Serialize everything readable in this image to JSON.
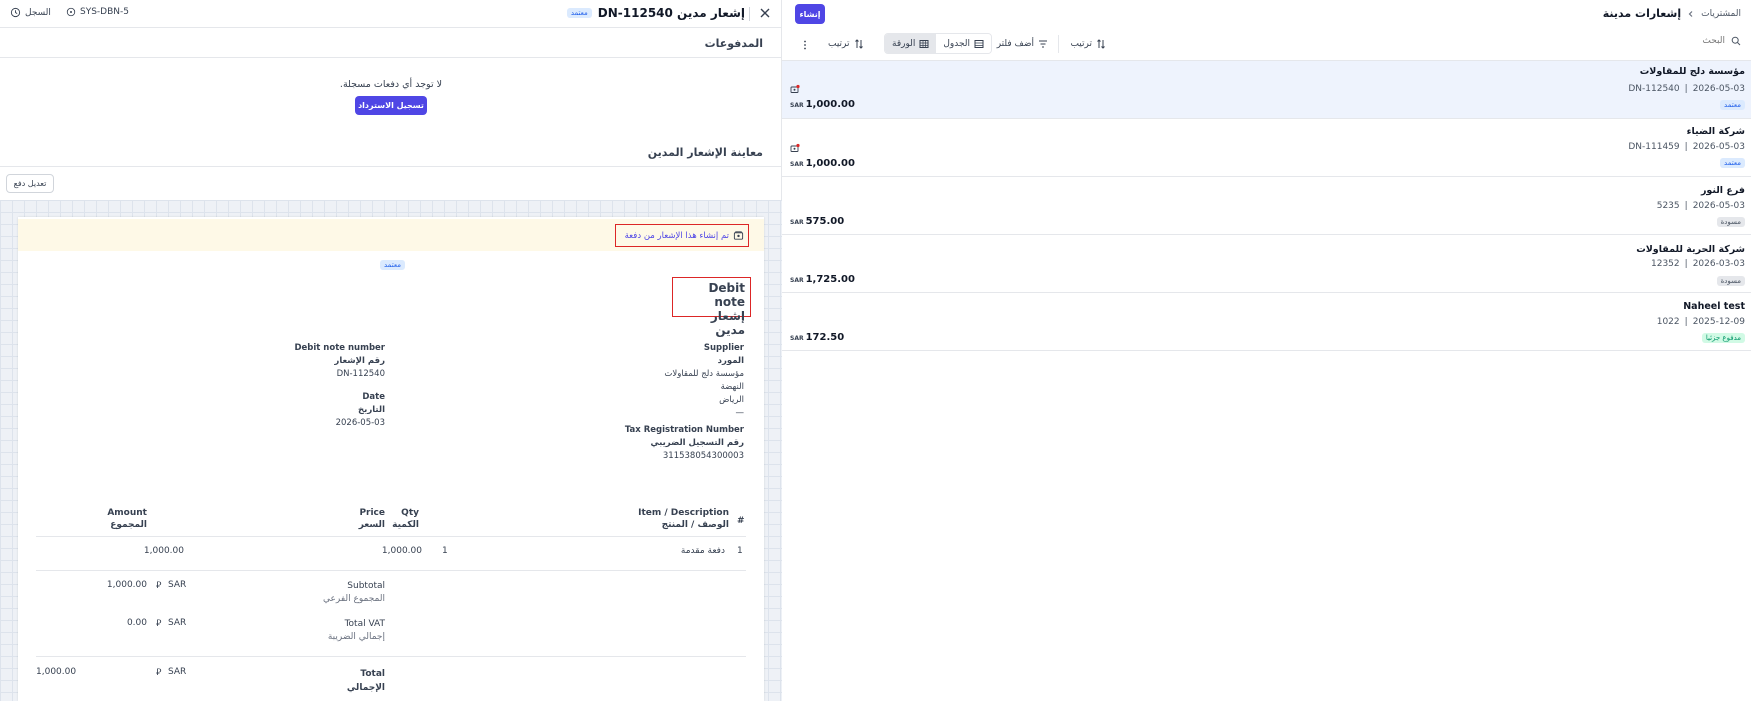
{
  "detail": {
    "header": {
      "title": "إشعار مدين DN-112540",
      "status_badge": "معتمد",
      "doc_ref": "SYS-DBN-5",
      "history_label": "السجل"
    },
    "payments": {
      "title": "المدفوعات",
      "empty_text": "لا توجد أي دفعات مسجلة.",
      "record_refund_label": "تسجيل الاسترداد"
    },
    "preview": {
      "title": "معاينة الإشعار المدين",
      "edit_payment_label": "تعديل دفع"
    },
    "document": {
      "banner_text": "تم إنشاء هذا الإشعار من دفعة",
      "status_badge": "معتمد",
      "title_en": "Debit note",
      "title_ar": "إشعار مدين",
      "supplier_label_en": "Supplier",
      "supplier_label_ar": "المورد",
      "supplier_name": "مؤسسة دلج للمقاولات",
      "supplier_district": "النهضة",
      "supplier_city": "الرياض",
      "supplier_extra": "—",
      "trn_label_en": "Tax Registration Number",
      "trn_label_ar": "رقم التسجيل الضريبي",
      "trn_value": "311538054300003",
      "number_label_en": "Debit note number",
      "number_label_ar": "رقم الإشعار",
      "number_value": "DN-112540",
      "date_label_en": "Date",
      "date_label_ar": "التاريخ",
      "date_value": "2026-05-03",
      "table": {
        "col_num": "#",
        "col_item_en": "Item / Description",
        "col_item_ar": "الوصف / المنتج",
        "col_qty_en": "Qty",
        "col_qty_ar": "الكمية",
        "col_price_en": "Price",
        "col_price_ar": "السعر",
        "col_amount_en": "Amount",
        "col_amount_ar": "المجموع",
        "rows": [
          {
            "num": "1",
            "item": "دفعة مقدمة",
            "qty": "1",
            "price": "1,000.00",
            "amount": "1,000.00"
          }
        ]
      },
      "subtotal_label_en": "Subtotal",
      "subtotal_label_ar": "المجموع الفرعي",
      "subtotal_currency": "SAR",
      "subtotal_value": "1,000.00",
      "vat_label_en": "Total VAT",
      "vat_label_ar": "إجمالي الضريبة",
      "vat_currency": "SAR",
      "vat_value": "0.00",
      "total_label_en": "Total",
      "total_label_ar": "الإجمالي",
      "total_currency": "SAR",
      "total_value": "1,000.00"
    }
  },
  "list": {
    "breadcrumb_parent": "المشتريات",
    "page_title": "إشعارات مدينة",
    "create_label": "إنشاء",
    "search_placeholder": "البحث",
    "sort_label": "ترتيب",
    "add_filter_label": "أضف فلتر",
    "view_table_label": "الجدول",
    "view_sheet_label": "الورقة",
    "sort_label_2": "ترتيب",
    "currency_small": "SAR",
    "rows": [
      {
        "name": "مؤسسة دلج للمقاولات",
        "date": "2026-05-03",
        "ref": "DN-112540",
        "status": "معتمد",
        "amount": "1,000.00"
      },
      {
        "name": "شركة الضياء",
        "date": "2026-05-03",
        "ref": "DN-111459",
        "status": "معتمد",
        "amount": "1,000.00"
      },
      {
        "name": "فرع النور",
        "date": "2026-05-03",
        "ref": "5235",
        "status": "مسودة",
        "amount": "575.00"
      },
      {
        "name": "شركة الحرية للمقاولات",
        "date": "2026-03-03",
        "ref": "12352",
        "status": "مسودة",
        "amount": "1,725.00"
      },
      {
        "name": "Naheel test",
        "date": "2025-12-09",
        "ref": "1022",
        "status": "مدفوع جزئيا",
        "amount": "172.50"
      }
    ]
  },
  "colors": {
    "accent": "#4f46e5",
    "selected_row": "#eef3fd",
    "highlight_box": "#dc2626",
    "banner": "#fef9e7"
  }
}
